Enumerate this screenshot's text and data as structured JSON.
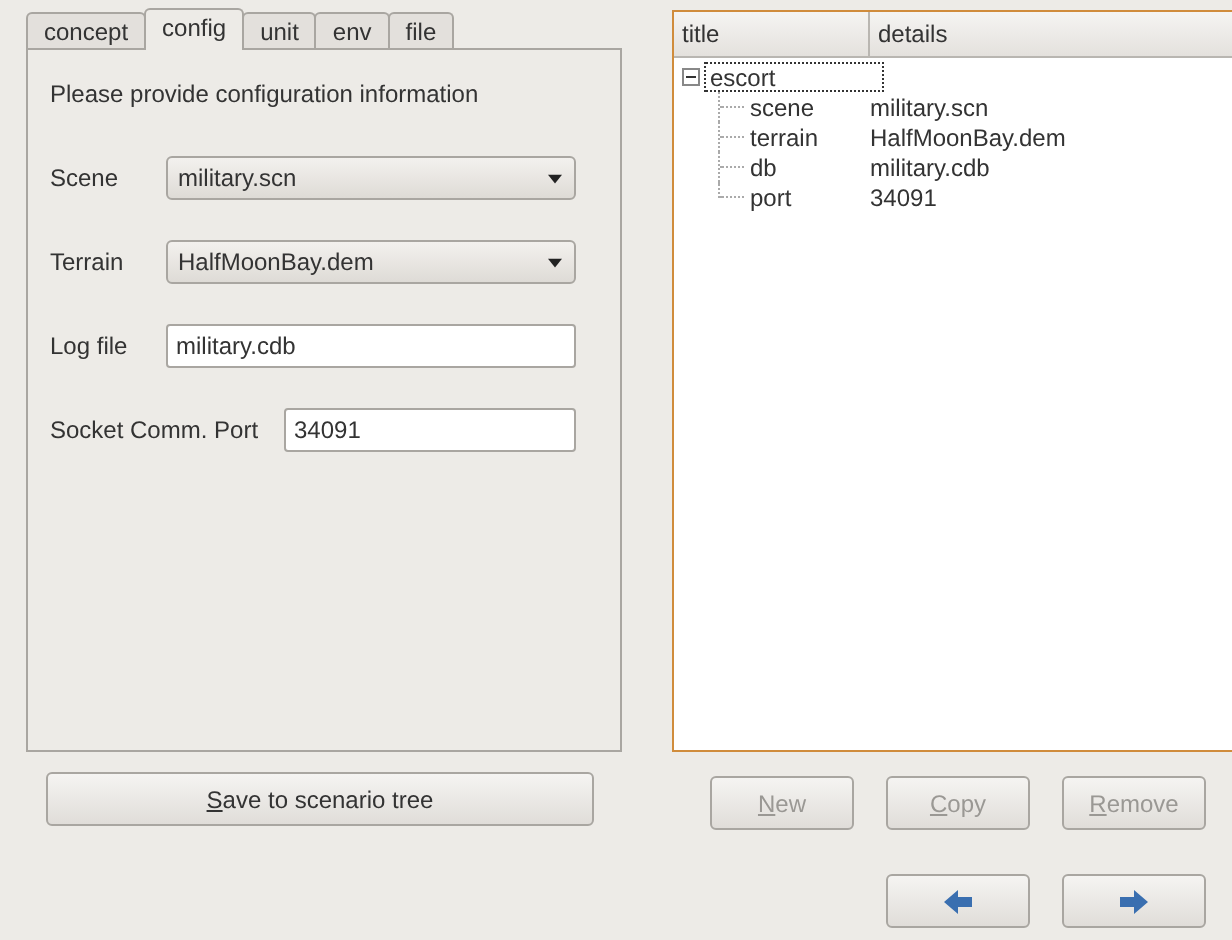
{
  "tabs": [
    {
      "label": "concept",
      "selected": false
    },
    {
      "label": "config",
      "selected": true
    },
    {
      "label": "unit",
      "selected": false
    },
    {
      "label": "env",
      "selected": false
    },
    {
      "label": "file",
      "selected": false
    }
  ],
  "intro": "Please provide configuration information",
  "fields": [
    {
      "kind": "combo",
      "label": "Scene",
      "value": "military.scn"
    },
    {
      "kind": "combo",
      "label": "Terrain",
      "value": "HalfMoonBay.dem"
    },
    {
      "kind": "text",
      "label": "Log file",
      "value": "military.cdb"
    },
    {
      "kind": "text",
      "label": "Socket Comm. Port",
      "value": "34091"
    }
  ],
  "save_button": {
    "key": "S",
    "rest": "ave to scenario tree"
  },
  "tree": {
    "columns": [
      "title",
      "details"
    ],
    "items": [
      {
        "title": "escort",
        "expanded": true,
        "focused": true,
        "children": [
          {
            "title": "scene",
            "details": "military.scn"
          },
          {
            "title": "terrain",
            "details": "HalfMoonBay.dem"
          },
          {
            "title": "db",
            "details": "military.cdb"
          },
          {
            "title": "port",
            "details": "34091"
          }
        ]
      }
    ]
  },
  "buttons": [
    {
      "key": "N",
      "rest": "ew",
      "disabled": true
    },
    {
      "key": "C",
      "rest": "opy",
      "disabled": true
    },
    {
      "key": "R",
      "rest": "emove",
      "disabled": true
    }
  ],
  "nav_buttons": [
    {
      "kind": "back"
    },
    {
      "kind": "forward"
    }
  ]
}
